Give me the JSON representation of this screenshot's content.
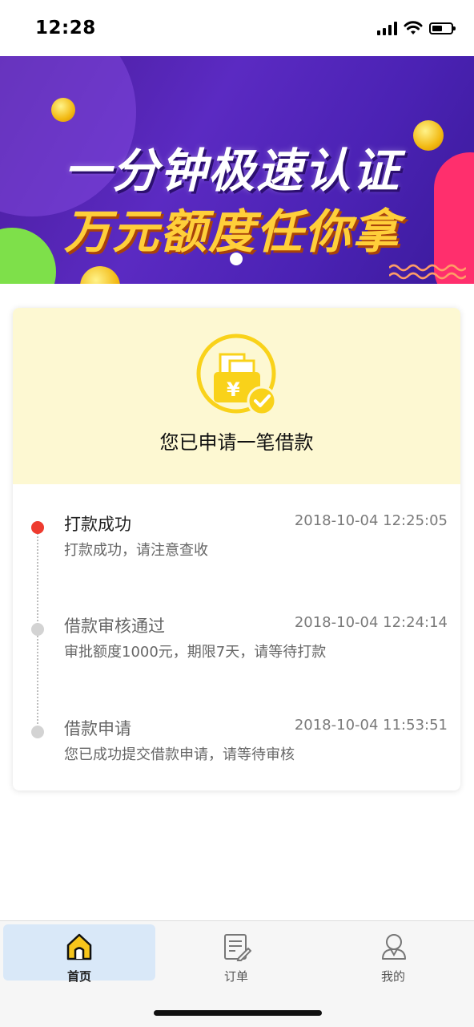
{
  "status_bar": {
    "time": "12:28"
  },
  "banner": {
    "line1": "一分钟极速认证",
    "line2": "万元额度任你拿"
  },
  "card": {
    "title": "您已申请一笔借款",
    "icon": "wallet-yen-check-icon",
    "accent_color": "#fdf8d2"
  },
  "timeline": [
    {
      "title": "打款成功",
      "time": "2018-10-04 12:25:05",
      "desc": "打款成功，请注意查收",
      "active": true
    },
    {
      "title": "借款审核通过",
      "time": "2018-10-04 12:24:14",
      "desc": "审批额度1000元，期限7天，请等待打款",
      "active": false
    },
    {
      "title": "借款申请",
      "time": "2018-10-04 11:53:51",
      "desc": "您已成功提交借款申请，请等待审核",
      "active": false
    }
  ],
  "tabbar": {
    "home": "首页",
    "orders": "订单",
    "mine": "我的"
  },
  "colors": {
    "active_dot": "#ee3b2f",
    "inactive_dot": "#d3d3d3",
    "selected_tab": "#d9e8f8"
  }
}
